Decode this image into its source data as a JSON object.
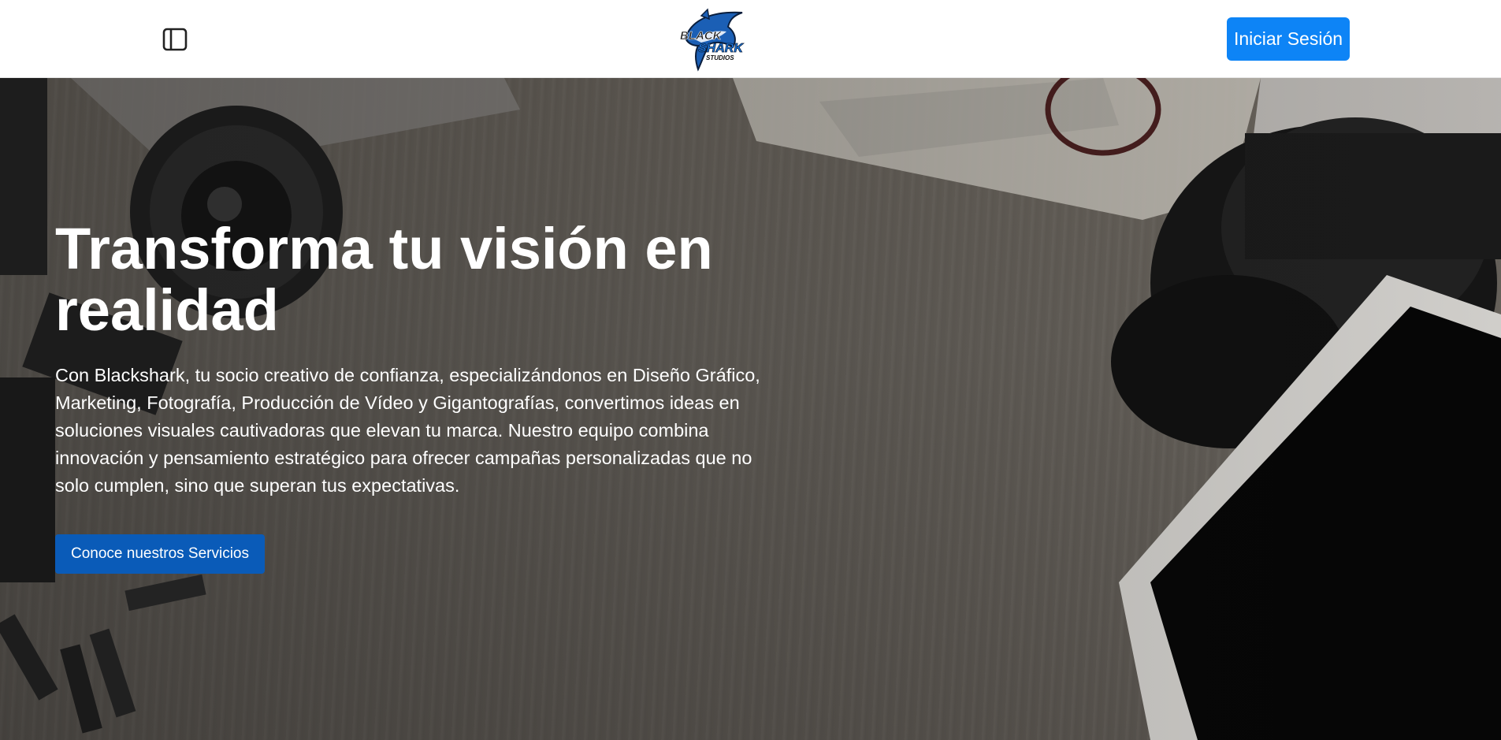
{
  "header": {
    "sidebar_toggle_icon": "sidebar-panel-icon",
    "logo": {
      "line1": "BLACK",
      "line2": "SHARK",
      "line3": "STUDIOS"
    },
    "login_label": "Iniciar Sesión"
  },
  "hero": {
    "title": "Transforma tu visión en realidad",
    "description": "Con Blackshark, tu socio creativo de confianza, especializándonos en Diseño Gráfico, Marketing, Fotografía, Producción de Vídeo y Gigantografías, convertimos ideas en soluciones visuales cautivadoras que elevan tu marca. Nuestro equipo combina innovación y pensamiento estratégico para ofrecer campañas personalizadas que no solo cumplen, sino que superan tus expectativas.",
    "cta_label": "Conoce nuestros Servicios"
  },
  "colors": {
    "login_button": "#0d84f6",
    "cta_button": "#0a5bb8",
    "hero_text": "#ffffff"
  }
}
